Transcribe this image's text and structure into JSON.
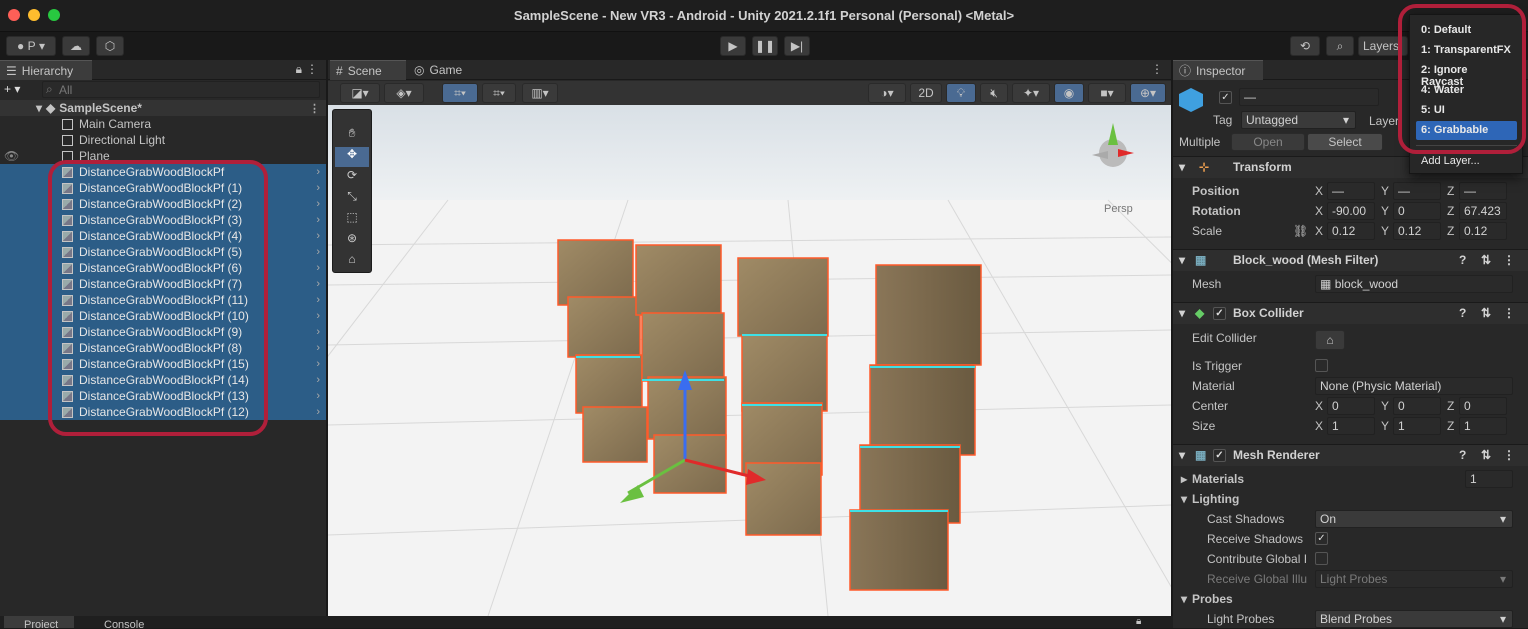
{
  "window": {
    "title": "SampleScene - New VR3 - Android - Unity 2021.2.1f1 Personal (Personal) <Metal>"
  },
  "toolbar": {
    "account_label": "P",
    "layers_label": "Layers"
  },
  "hierarchy": {
    "tab": "Hierarchy",
    "search_placeholder": "All",
    "scene": "SampleScene*",
    "items": [
      "Main Camera",
      "Directional Light",
      "Plane",
      "DistanceGrabWoodBlockPf",
      "DistanceGrabWoodBlockPf (1)",
      "DistanceGrabWoodBlockPf (2)",
      "DistanceGrabWoodBlockPf (3)",
      "DistanceGrabWoodBlockPf (4)",
      "DistanceGrabWoodBlockPf (5)",
      "DistanceGrabWoodBlockPf (6)",
      "DistanceGrabWoodBlockPf (7)",
      "DistanceGrabWoodBlockPf (11)",
      "DistanceGrabWoodBlockPf (10)",
      "DistanceGrabWoodBlockPf (9)",
      "DistanceGrabWoodBlockPf (8)",
      "DistanceGrabWoodBlockPf (15)",
      "DistanceGrabWoodBlockPf (14)",
      "DistanceGrabWoodBlockPf (13)",
      "DistanceGrabWoodBlockPf (12)"
    ]
  },
  "scene_view": {
    "tabs": [
      "Scene",
      "Game"
    ],
    "mode_2d": "2D",
    "persp": "Persp"
  },
  "inspector": {
    "tab": "Inspector",
    "name_value": "—",
    "tag_label": "Tag",
    "tag_value": "Untagged",
    "layer_label": "Layer",
    "multiple_label": "Multiple",
    "open_button": "Open",
    "select_button": "Select",
    "transform": {
      "title": "Transform",
      "position_label": "Position",
      "position": [
        "—",
        "—",
        "—"
      ],
      "rotation_label": "Rotation",
      "rotation": [
        "-90.00",
        "0",
        "67.423"
      ],
      "scale_label": "Scale",
      "scale": [
        "0.12",
        "0.12",
        "0.12"
      ]
    },
    "mesh_filter": {
      "title": "Block_wood (Mesh Filter)",
      "mesh_label": "Mesh",
      "mesh_value": "block_wood"
    },
    "box_collider": {
      "title": "Box Collider",
      "edit_label": "Edit Collider",
      "trigger_label": "Is Trigger",
      "material_label": "Material",
      "material_value": "None (Physic Material)",
      "center_label": "Center",
      "center": [
        "0",
        "0",
        "0"
      ],
      "size_label": "Size",
      "size": [
        "1",
        "1",
        "1"
      ]
    },
    "mesh_renderer": {
      "title": "Mesh Renderer",
      "materials_label": "Materials",
      "materials_count": "1",
      "lighting_label": "Lighting",
      "cast_shadows_label": "Cast Shadows",
      "cast_shadows_value": "On",
      "receive_shadows_label": "Receive Shadows",
      "contribute_gi_label": "Contribute Global I",
      "receive_gi_label": "Receive Global Illu",
      "receive_gi_value": "Light Probes",
      "probes_label": "Probes",
      "light_probes_label": "Light Probes",
      "light_probes_value": "Blend Probes"
    },
    "axes": [
      "X",
      "Y",
      "Z"
    ]
  },
  "layer_dropdown": {
    "items": [
      "0: Default",
      "1: TransparentFX",
      "2: Ignore Raycast",
      "4: Water",
      "5: UI",
      "6: Grabbable"
    ],
    "selected": "6: Grabbable",
    "add_layer": "Add Layer..."
  },
  "bottom_tabs": [
    "Project",
    "Console"
  ],
  "colors": {
    "selection": "#2c5d87",
    "accent": "#2e66b7",
    "highlight_ring": "#b01f3a"
  }
}
